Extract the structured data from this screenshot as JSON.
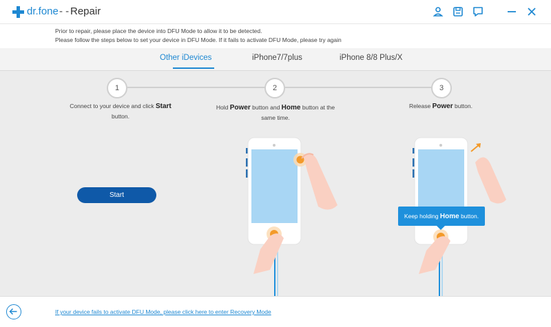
{
  "titlebar": {
    "brand": "dr.fone",
    "separator": "- -",
    "title": "Repair",
    "icons": [
      "user-icon",
      "save-icon",
      "feedback-icon",
      "minimize-icon",
      "close-icon"
    ]
  },
  "info": {
    "line1": "Prior to repair, please place the device into DFU Mode to allow it to be detected.",
    "line2": "Please follow the steps below to set your device in DFU Mode. If it fails to activate DFU Mode, please try again"
  },
  "tabs": [
    {
      "label": "Other iDevices",
      "active": true
    },
    {
      "label": "iPhone7/7plus",
      "active": false
    },
    {
      "label": "iPhone 8/8 Plus/X",
      "active": false
    }
  ],
  "steps": [
    {
      "number": "1",
      "pre": "Connect to your device and click ",
      "strong1": "Start",
      "mid": "",
      "strong2": "",
      "post": "button."
    },
    {
      "number": "2",
      "pre": "Hold ",
      "strong1": "Power",
      "mid": " button and ",
      "strong2": "Home",
      "post": " button at the same time."
    },
    {
      "number": "3",
      "pre": "Release ",
      "strong1": "Power",
      "mid": "",
      "strong2": "",
      "post": " button."
    }
  ],
  "start_button": "Start",
  "tooltip": {
    "pre": "Keep holding ",
    "strong": "Home",
    "post": " button."
  },
  "footer": {
    "link": "If your device fails to activate DFU Mode, please click here to enter Recovery Mode"
  },
  "colors": {
    "accent": "#1e88d2",
    "button": "#0f59a8",
    "tooltip": "#1e90dc",
    "press": "#f39a2a"
  }
}
